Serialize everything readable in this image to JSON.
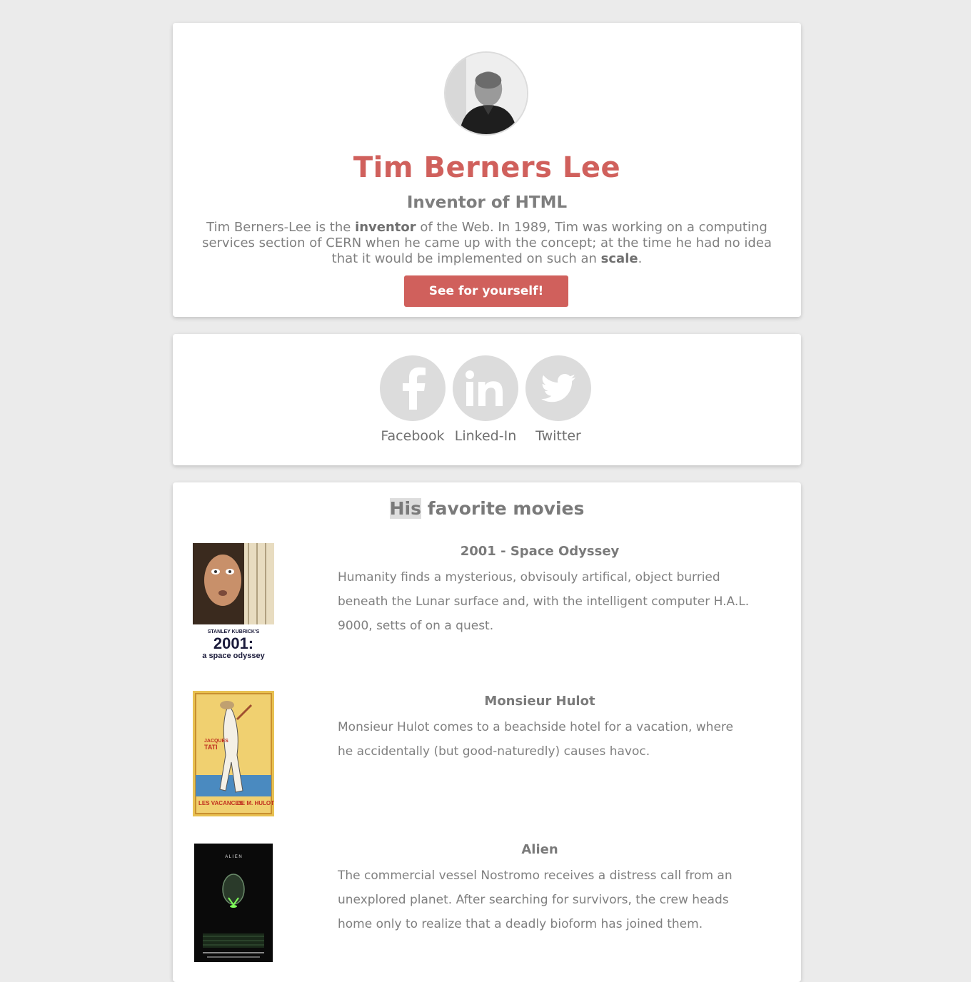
{
  "profile": {
    "name": "Tim Berners Lee",
    "role": "Inventor of HTML",
    "bio": {
      "part1": "Tim Berners-Lee is the ",
      "bold1": "inventor",
      "part2": " of the Web. In 1989, Tim was working on a computing services section of CERN when he came up with the concept; at the time he had no idea that it would be implemented on such an ",
      "bold2": "scale",
      "part3": "."
    },
    "cta_label": "See for yourself!"
  },
  "social": [
    {
      "label": "Facebook",
      "icon": "facebook-icon"
    },
    {
      "label": "Linked-In",
      "icon": "linkedin-icon"
    },
    {
      "label": "Twitter",
      "icon": "twitter-icon"
    }
  ],
  "movies": {
    "title_highlight": "His",
    "title_rest": " favorite movies",
    "items": [
      {
        "title": "2001 - Space Odyssey",
        "description": "Humanity finds a mysterious, obvisouly artifical, object burried beneath the Lunar surface and, with the intelligent computer H.A.L. 9000, setts of on a quest.",
        "poster_text": [
          "STANLEY KUBRICK'S",
          "2001:",
          "a space odyssey"
        ]
      },
      {
        "title": "Monsieur Hulot",
        "description": "Monsieur Hulot comes to a beachside hotel for a vacation, where he accidentally (but good-naturedly) causes havoc.",
        "poster_text": [
          "JACQUES",
          "TATI",
          "LES VACANCES",
          "DE M. HULOT"
        ]
      },
      {
        "title": "Alien",
        "description": "The commercial vessel Nostromo receives a distress call from an unexplored planet. After searching for survivors, the crew heads home only to realize that a deadly bioform has joined them.",
        "poster_text": [
          "A L I E N"
        ]
      }
    ]
  },
  "colors": {
    "accent": "#d0605c",
    "background": "#ebebeb",
    "icon_circle": "#dcdcdc"
  }
}
